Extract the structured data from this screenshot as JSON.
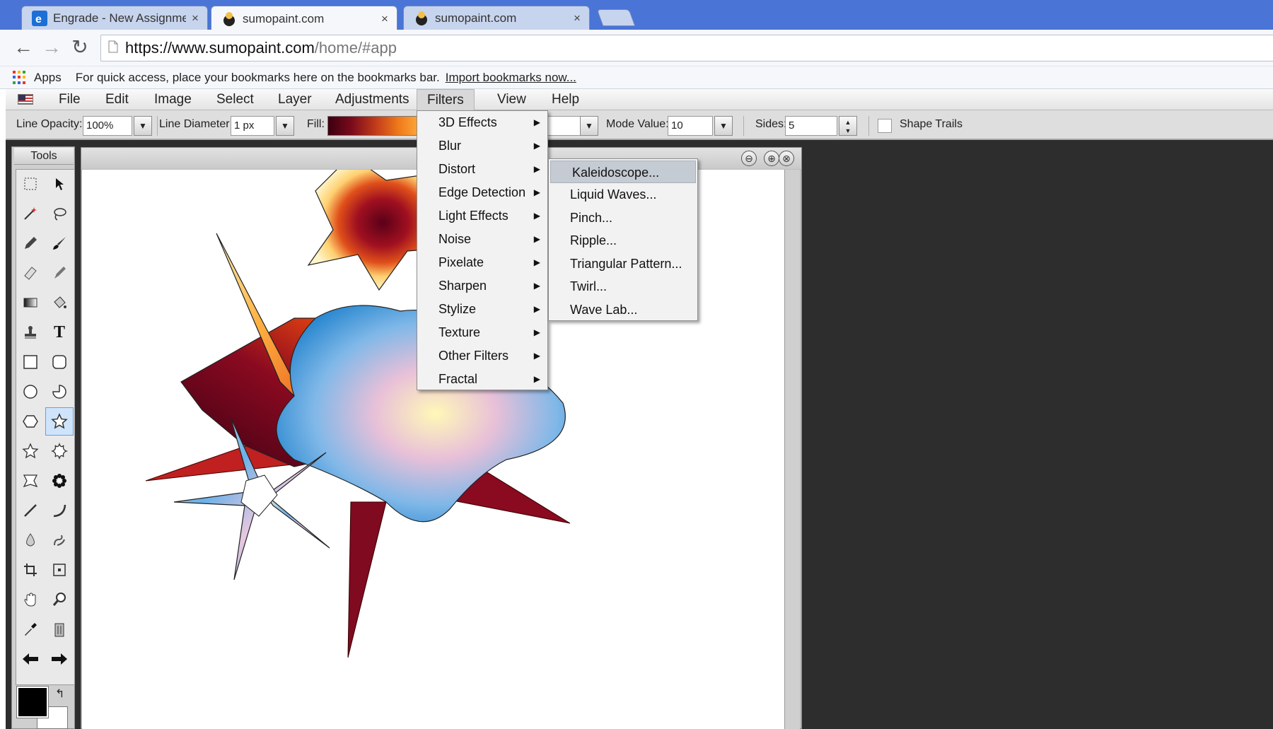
{
  "browser": {
    "tabs": [
      {
        "title": "Engrade - New Assignment",
        "close": "×",
        "active": false
      },
      {
        "title": "sumopaint.com",
        "close": "×",
        "active": true
      },
      {
        "title": "sumopaint.com",
        "close": "×",
        "active": false
      }
    ],
    "url_host": "https://www.sumopaint.com",
    "url_path": "/home/#app",
    "bookmarks": {
      "apps_label": "Apps",
      "message": "For quick access, place your bookmarks here on the bookmarks bar.",
      "import_link": "Import bookmarks now..."
    },
    "colors": {
      "tabbar": "#4a74d6",
      "chrome": "#f5f7fb"
    }
  },
  "menubar": {
    "items": [
      "File",
      "Edit",
      "Image",
      "Select",
      "Layer",
      "Adjustments",
      "Filters",
      "View",
      "Help"
    ],
    "open_menu": "Filters"
  },
  "options": {
    "line_opacity_label": "Line Opacity:",
    "line_opacity_value": "100%",
    "line_diameter_label": "Line Diameter:",
    "line_diameter_value": "1 px",
    "fill_label": "Fill:",
    "mode_value_label": "Mode Value:",
    "mode_value": "10",
    "sides_label": "Sides:",
    "sides_value": "5",
    "shape_trails_label": "Shape Trails",
    "shape_trails_checked": false
  },
  "tools": {
    "title": "Tools",
    "selected": "star-tool",
    "icons": [
      "marquee",
      "move",
      "magic-wand",
      "lasso",
      "pencil",
      "brush",
      "eraser",
      "smudge",
      "gradient",
      "fill-bucket",
      "stamp",
      "text",
      "rectangle",
      "rounded-rectangle",
      "ellipse",
      "arc",
      "polygon",
      "star",
      "star-outline",
      "burst",
      "shape-custom",
      "flower",
      "line",
      "curve",
      "blur-drop",
      "liquify",
      "crop",
      "transform",
      "hand",
      "zoom",
      "color-picker",
      "trash",
      "undo-arrow",
      "redo-arrow"
    ],
    "foreground_color": "#000000",
    "background_color": "#ffffff"
  },
  "filters_menu": {
    "items": [
      {
        "label": "3D Effects",
        "submenu": true
      },
      {
        "label": "Blur",
        "submenu": true
      },
      {
        "label": "Distort",
        "submenu": true
      },
      {
        "label": "Edge Detection",
        "submenu": true
      },
      {
        "label": "Light Effects",
        "submenu": true
      },
      {
        "label": "Noise",
        "submenu": true
      },
      {
        "label": "Pixelate",
        "submenu": true
      },
      {
        "label": "Sharpen",
        "submenu": true
      },
      {
        "label": "Stylize",
        "submenu": true
      },
      {
        "label": "Texture",
        "submenu": true
      },
      {
        "label": "Other Filters",
        "submenu": true
      },
      {
        "label": "Fractal",
        "submenu": true
      }
    ],
    "arrow": "▶"
  },
  "distort_submenu": {
    "items": [
      "Kaleidoscope...",
      "Liquid Waves...",
      "Pinch...",
      "Ripple...",
      "Triangular Pattern...",
      "Twirl...",
      "Wave Lab..."
    ],
    "highlighted": "Kaleidoscope..."
  },
  "document": {
    "window_buttons": [
      "⊖",
      "⊕",
      "⊗"
    ],
    "workspace_color": "#2d2d2d"
  }
}
